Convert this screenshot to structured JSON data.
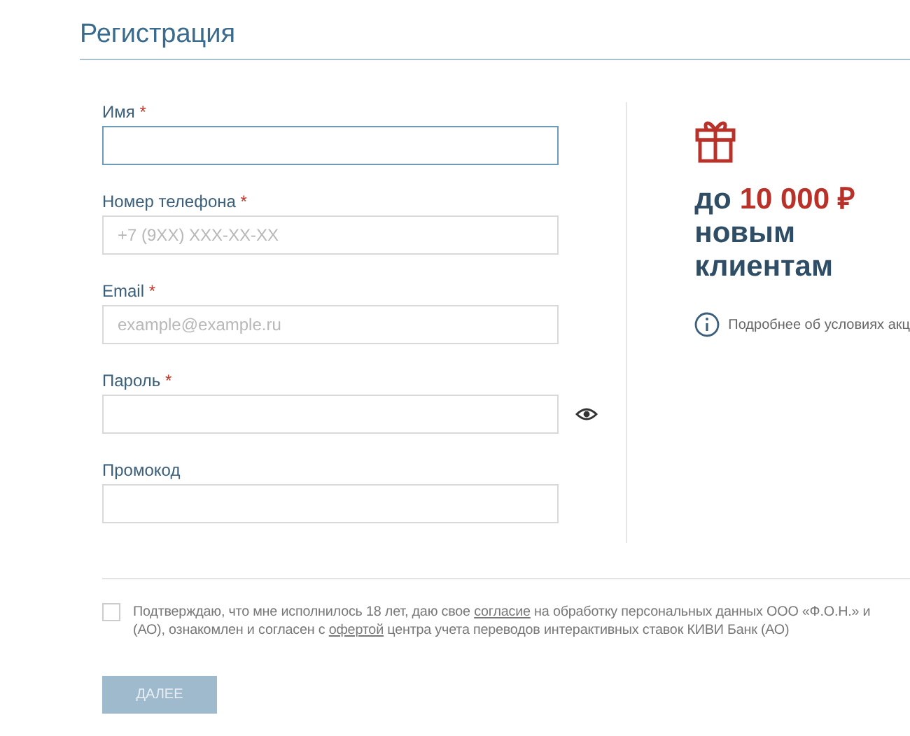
{
  "title": "Регистрация",
  "fields": [
    {
      "label": "Имя",
      "required": true,
      "focused": true,
      "kind": "text"
    },
    {
      "label": "Номер телефона",
      "required": true,
      "focused": false,
      "kind": "text",
      "placeholder": "+7 (9XX) XXX-XX-XX"
    },
    {
      "label": "Email",
      "required": true,
      "focused": false,
      "kind": "text",
      "placeholder": "example@example.ru"
    },
    {
      "label": "Пароль",
      "required": true,
      "focused": false,
      "kind": "password"
    },
    {
      "label": "Промокод",
      "required": false,
      "focused": false,
      "kind": "text"
    }
  ],
  "required_mark": "*",
  "promo": {
    "prefix": "до",
    "amount": "10 000 ₽",
    "lines": [
      "новым",
      "клиентам"
    ],
    "details_link": "Подробнее об условиях акц"
  },
  "consent": {
    "checked": false,
    "parts": [
      {
        "kind": "text",
        "text": "Подтверждаю, что мне исполнилось 18 лет, даю свое "
      },
      {
        "kind": "link",
        "text": "согласие"
      },
      {
        "kind": "text",
        "text": " на обработку персональных данных ООО «Ф.О.Н.» и\n(АО), ознакомлен и согласен с "
      },
      {
        "kind": "link",
        "text": "офертой"
      },
      {
        "kind": "text",
        "text": " центра учета переводов интерактивных ставок КИВИ Банк (АО)"
      }
    ]
  },
  "submit": {
    "label": "ДАЛЕЕ",
    "disabled": true
  }
}
